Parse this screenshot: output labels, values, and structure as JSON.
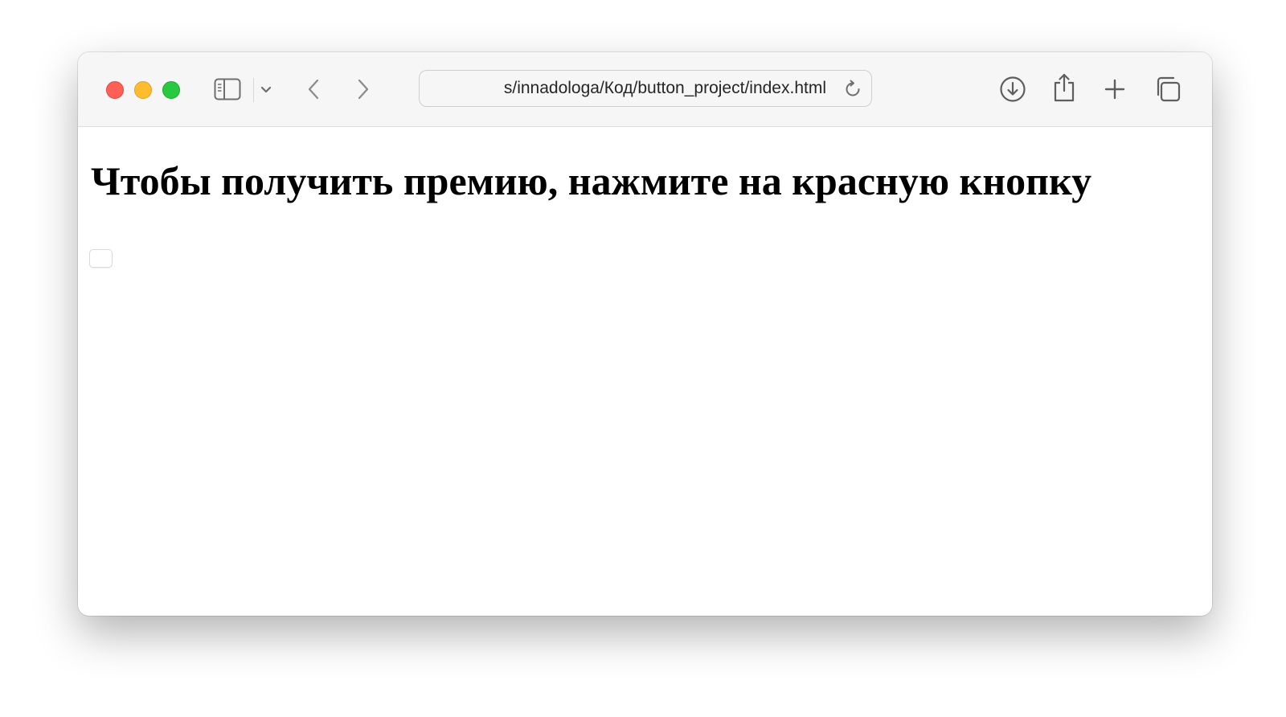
{
  "browser": {
    "address_bar": {
      "url": "s/innadologa/Код/button_project/index.html"
    },
    "icons": {
      "sidebar": "sidebar-icon",
      "chevron": "chevron-down-icon",
      "back": "chevron-left-icon",
      "forward": "chevron-right-icon",
      "reload": "reload-icon",
      "download": "download-icon",
      "share": "share-icon",
      "new_tab": "plus-icon",
      "tab_overview": "tabs-overview-icon"
    },
    "colors": {
      "close": "#fe5f57",
      "minimize": "#febc2e",
      "maximize": "#28c840"
    }
  },
  "page": {
    "heading": "Чтобы получить премию, нажмите на красную кнопку",
    "button_label": ""
  }
}
